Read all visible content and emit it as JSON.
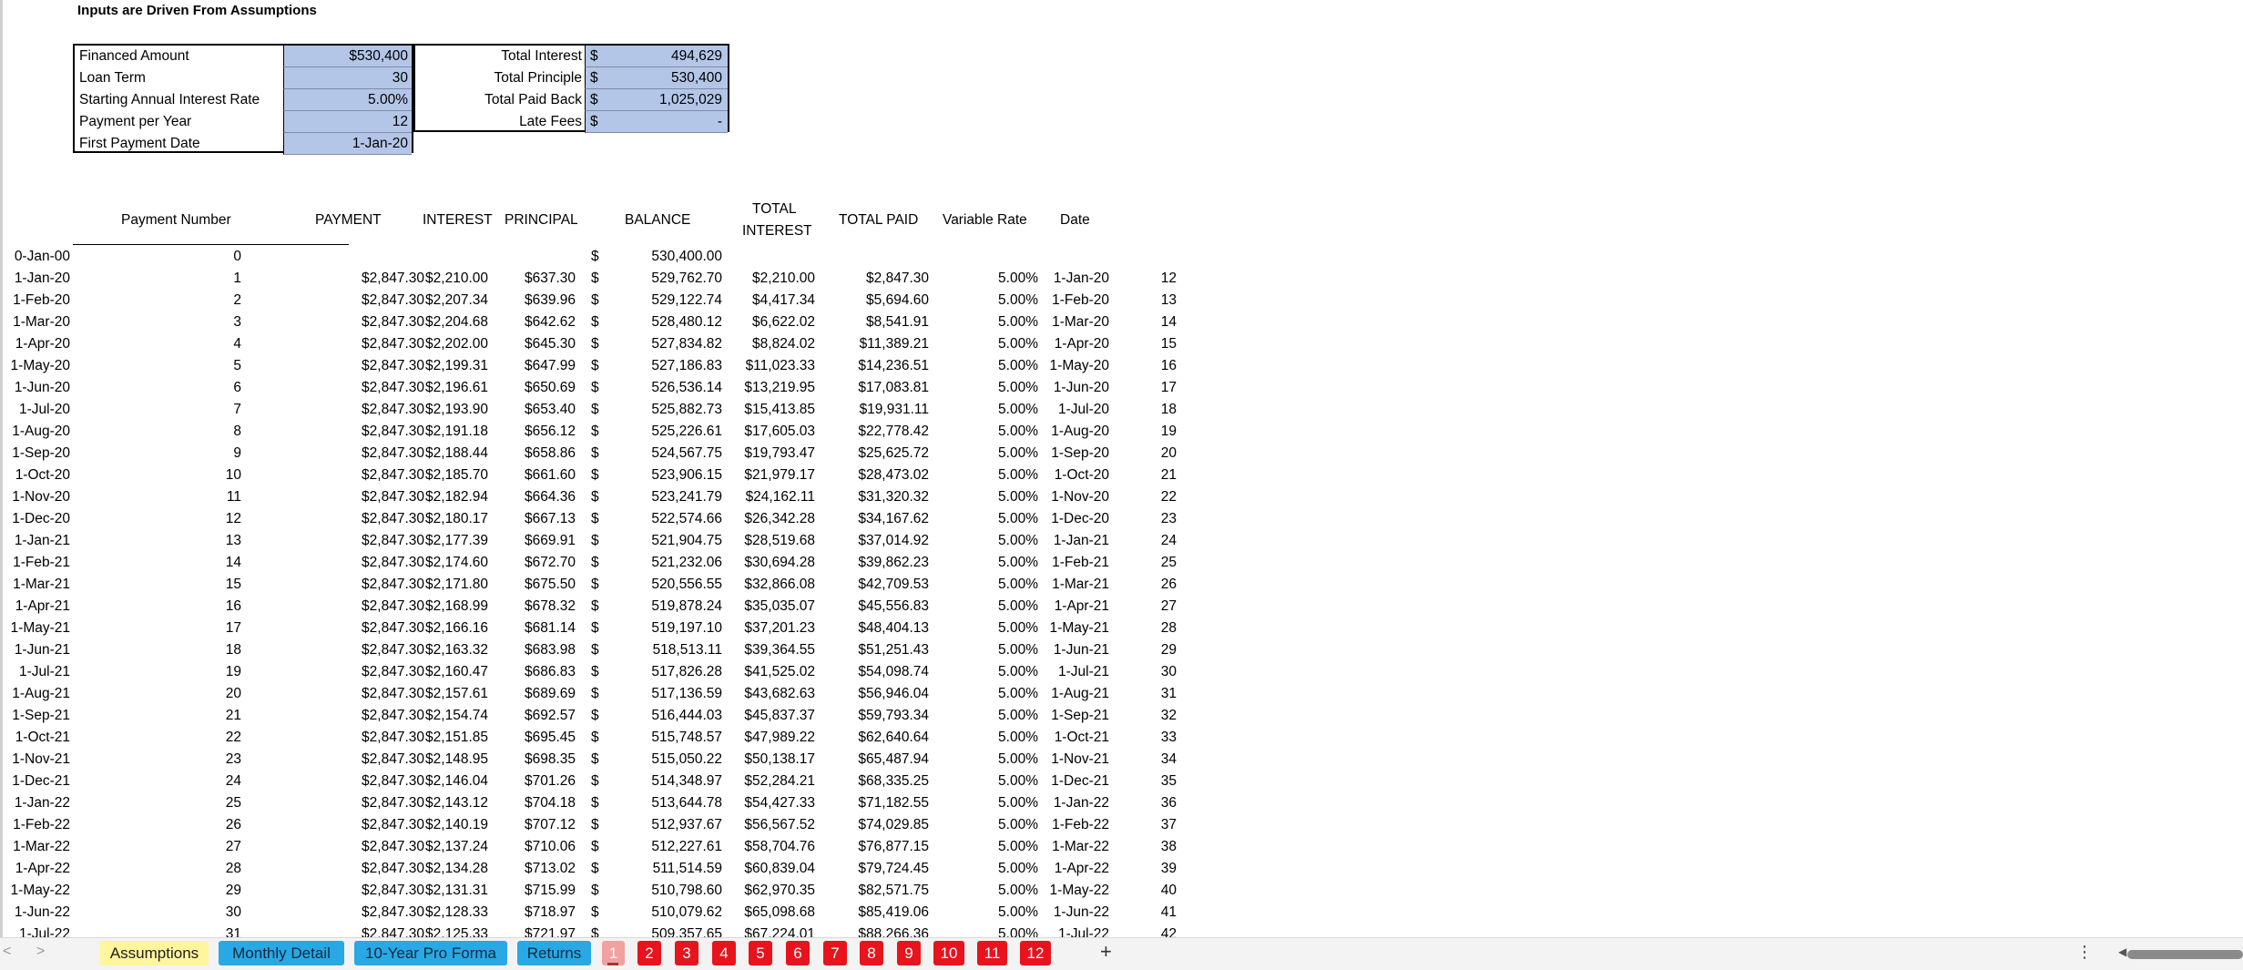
{
  "heading": "Inputs are Driven From Assumptions",
  "inputs": [
    {
      "label": "Financed Amount",
      "value": "$530,400"
    },
    {
      "label": "Loan Term",
      "value": "30"
    },
    {
      "label": "Starting Annual Interest Rate",
      "value": "5.00%"
    },
    {
      "label": "Payment per Year",
      "value": "12"
    },
    {
      "label": "First Payment Date",
      "value": "1-Jan-20"
    }
  ],
  "summary": [
    {
      "label": "Total Interest",
      "currency": "$",
      "value": "494,629"
    },
    {
      "label": "Total Principle",
      "currency": "$",
      "value": "530,400"
    },
    {
      "label": "Total Paid Back",
      "currency": "$",
      "value": "1,025,029"
    },
    {
      "label": "Late Fees",
      "currency": "$",
      "value": "-"
    }
  ],
  "headers": {
    "payment_number": "Payment Number",
    "payment": "PAYMENT",
    "interest": "INTEREST",
    "principal": "PRINCIPAL",
    "balance": "BALANCE",
    "total_interest_1": "TOTAL",
    "total_interest_2": "INTEREST",
    "total_paid": "TOTAL PAID",
    "variable_rate": "Variable  Rate",
    "date": "Date"
  },
  "rows": [
    {
      "date": "0-Jan-00",
      "num": "0",
      "payment": "",
      "interest": "",
      "principal": "",
      "dollar": "$",
      "balance": "530,400.00",
      "total_interest": "",
      "total_paid": "",
      "rate": "",
      "vdate": "",
      "idx": ""
    },
    {
      "date": "1-Jan-20",
      "num": "1",
      "payment": "$2,847.30",
      "interest": "$2,210.00",
      "principal": "$637.30",
      "dollar": "$",
      "balance": "529,762.70",
      "total_interest": "$2,210.00",
      "total_paid": "$2,847.30",
      "rate": "5.00%",
      "vdate": "1-Jan-20",
      "idx": "12"
    },
    {
      "date": "1-Feb-20",
      "num": "2",
      "payment": "$2,847.30",
      "interest": "$2,207.34",
      "principal": "$639.96",
      "dollar": "$",
      "balance": "529,122.74",
      "total_interest": "$4,417.34",
      "total_paid": "$5,694.60",
      "rate": "5.00%",
      "vdate": "1-Feb-20",
      "idx": "13"
    },
    {
      "date": "1-Mar-20",
      "num": "3",
      "payment": "$2,847.30",
      "interest": "$2,204.68",
      "principal": "$642.62",
      "dollar": "$",
      "balance": "528,480.12",
      "total_interest": "$6,622.02",
      "total_paid": "$8,541.91",
      "rate": "5.00%",
      "vdate": "1-Mar-20",
      "idx": "14"
    },
    {
      "date": "1-Apr-20",
      "num": "4",
      "payment": "$2,847.30",
      "interest": "$2,202.00",
      "principal": "$645.30",
      "dollar": "$",
      "balance": "527,834.82",
      "total_interest": "$8,824.02",
      "total_paid": "$11,389.21",
      "rate": "5.00%",
      "vdate": "1-Apr-20",
      "idx": "15"
    },
    {
      "date": "1-May-20",
      "num": "5",
      "payment": "$2,847.30",
      "interest": "$2,199.31",
      "principal": "$647.99",
      "dollar": "$",
      "balance": "527,186.83",
      "total_interest": "$11,023.33",
      "total_paid": "$14,236.51",
      "rate": "5.00%",
      "vdate": "1-May-20",
      "idx": "16"
    },
    {
      "date": "1-Jun-20",
      "num": "6",
      "payment": "$2,847.30",
      "interest": "$2,196.61",
      "principal": "$650.69",
      "dollar": "$",
      "balance": "526,536.14",
      "total_interest": "$13,219.95",
      "total_paid": "$17,083.81",
      "rate": "5.00%",
      "vdate": "1-Jun-20",
      "idx": "17"
    },
    {
      "date": "1-Jul-20",
      "num": "7",
      "payment": "$2,847.30",
      "interest": "$2,193.90",
      "principal": "$653.40",
      "dollar": "$",
      "balance": "525,882.73",
      "total_interest": "$15,413.85",
      "total_paid": "$19,931.11",
      "rate": "5.00%",
      "vdate": "1-Jul-20",
      "idx": "18"
    },
    {
      "date": "1-Aug-20",
      "num": "8",
      "payment": "$2,847.30",
      "interest": "$2,191.18",
      "principal": "$656.12",
      "dollar": "$",
      "balance": "525,226.61",
      "total_interest": "$17,605.03",
      "total_paid": "$22,778.42",
      "rate": "5.00%",
      "vdate": "1-Aug-20",
      "idx": "19"
    },
    {
      "date": "1-Sep-20",
      "num": "9",
      "payment": "$2,847.30",
      "interest": "$2,188.44",
      "principal": "$658.86",
      "dollar": "$",
      "balance": "524,567.75",
      "total_interest": "$19,793.47",
      "total_paid": "$25,625.72",
      "rate": "5.00%",
      "vdate": "1-Sep-20",
      "idx": "20"
    },
    {
      "date": "1-Oct-20",
      "num": "10",
      "payment": "$2,847.30",
      "interest": "$2,185.70",
      "principal": "$661.60",
      "dollar": "$",
      "balance": "523,906.15",
      "total_interest": "$21,979.17",
      "total_paid": "$28,473.02",
      "rate": "5.00%",
      "vdate": "1-Oct-20",
      "idx": "21"
    },
    {
      "date": "1-Nov-20",
      "num": "11",
      "payment": "$2,847.30",
      "interest": "$2,182.94",
      "principal": "$664.36",
      "dollar": "$",
      "balance": "523,241.79",
      "total_interest": "$24,162.11",
      "total_paid": "$31,320.32",
      "rate": "5.00%",
      "vdate": "1-Nov-20",
      "idx": "22"
    },
    {
      "date": "1-Dec-20",
      "num": "12",
      "payment": "$2,847.30",
      "interest": "$2,180.17",
      "principal": "$667.13",
      "dollar": "$",
      "balance": "522,574.66",
      "total_interest": "$26,342.28",
      "total_paid": "$34,167.62",
      "rate": "5.00%",
      "vdate": "1-Dec-20",
      "idx": "23"
    },
    {
      "date": "1-Jan-21",
      "num": "13",
      "payment": "$2,847.30",
      "interest": "$2,177.39",
      "principal": "$669.91",
      "dollar": "$",
      "balance": "521,904.75",
      "total_interest": "$28,519.68",
      "total_paid": "$37,014.92",
      "rate": "5.00%",
      "vdate": "1-Jan-21",
      "idx": "24"
    },
    {
      "date": "1-Feb-21",
      "num": "14",
      "payment": "$2,847.30",
      "interest": "$2,174.60",
      "principal": "$672.70",
      "dollar": "$",
      "balance": "521,232.06",
      "total_interest": "$30,694.28",
      "total_paid": "$39,862.23",
      "rate": "5.00%",
      "vdate": "1-Feb-21",
      "idx": "25"
    },
    {
      "date": "1-Mar-21",
      "num": "15",
      "payment": "$2,847.30",
      "interest": "$2,171.80",
      "principal": "$675.50",
      "dollar": "$",
      "balance": "520,556.55",
      "total_interest": "$32,866.08",
      "total_paid": "$42,709.53",
      "rate": "5.00%",
      "vdate": "1-Mar-21",
      "idx": "26"
    },
    {
      "date": "1-Apr-21",
      "num": "16",
      "payment": "$2,847.30",
      "interest": "$2,168.99",
      "principal": "$678.32",
      "dollar": "$",
      "balance": "519,878.24",
      "total_interest": "$35,035.07",
      "total_paid": "$45,556.83",
      "rate": "5.00%",
      "vdate": "1-Apr-21",
      "idx": "27"
    },
    {
      "date": "1-May-21",
      "num": "17",
      "payment": "$2,847.30",
      "interest": "$2,166.16",
      "principal": "$681.14",
      "dollar": "$",
      "balance": "519,197.10",
      "total_interest": "$37,201.23",
      "total_paid": "$48,404.13",
      "rate": "5.00%",
      "vdate": "1-May-21",
      "idx": "28"
    },
    {
      "date": "1-Jun-21",
      "num": "18",
      "payment": "$2,847.30",
      "interest": "$2,163.32",
      "principal": "$683.98",
      "dollar": "$",
      "balance": "518,513.11",
      "total_interest": "$39,364.55",
      "total_paid": "$51,251.43",
      "rate": "5.00%",
      "vdate": "1-Jun-21",
      "idx": "29"
    },
    {
      "date": "1-Jul-21",
      "num": "19",
      "payment": "$2,847.30",
      "interest": "$2,160.47",
      "principal": "$686.83",
      "dollar": "$",
      "balance": "517,826.28",
      "total_interest": "$41,525.02",
      "total_paid": "$54,098.74",
      "rate": "5.00%",
      "vdate": "1-Jul-21",
      "idx": "30"
    },
    {
      "date": "1-Aug-21",
      "num": "20",
      "payment": "$2,847.30",
      "interest": "$2,157.61",
      "principal": "$689.69",
      "dollar": "$",
      "balance": "517,136.59",
      "total_interest": "$43,682.63",
      "total_paid": "$56,946.04",
      "rate": "5.00%",
      "vdate": "1-Aug-21",
      "idx": "31"
    },
    {
      "date": "1-Sep-21",
      "num": "21",
      "payment": "$2,847.30",
      "interest": "$2,154.74",
      "principal": "$692.57",
      "dollar": "$",
      "balance": "516,444.03",
      "total_interest": "$45,837.37",
      "total_paid": "$59,793.34",
      "rate": "5.00%",
      "vdate": "1-Sep-21",
      "idx": "32"
    },
    {
      "date": "1-Oct-21",
      "num": "22",
      "payment": "$2,847.30",
      "interest": "$2,151.85",
      "principal": "$695.45",
      "dollar": "$",
      "balance": "515,748.57",
      "total_interest": "$47,989.22",
      "total_paid": "$62,640.64",
      "rate": "5.00%",
      "vdate": "1-Oct-21",
      "idx": "33"
    },
    {
      "date": "1-Nov-21",
      "num": "23",
      "payment": "$2,847.30",
      "interest": "$2,148.95",
      "principal": "$698.35",
      "dollar": "$",
      "balance": "515,050.22",
      "total_interest": "$50,138.17",
      "total_paid": "$65,487.94",
      "rate": "5.00%",
      "vdate": "1-Nov-21",
      "idx": "34"
    },
    {
      "date": "1-Dec-21",
      "num": "24",
      "payment": "$2,847.30",
      "interest": "$2,146.04",
      "principal": "$701.26",
      "dollar": "$",
      "balance": "514,348.97",
      "total_interest": "$52,284.21",
      "total_paid": "$68,335.25",
      "rate": "5.00%",
      "vdate": "1-Dec-21",
      "idx": "35"
    },
    {
      "date": "1-Jan-22",
      "num": "25",
      "payment": "$2,847.30",
      "interest": "$2,143.12",
      "principal": "$704.18",
      "dollar": "$",
      "balance": "513,644.78",
      "total_interest": "$54,427.33",
      "total_paid": "$71,182.55",
      "rate": "5.00%",
      "vdate": "1-Jan-22",
      "idx": "36"
    },
    {
      "date": "1-Feb-22",
      "num": "26",
      "payment": "$2,847.30",
      "interest": "$2,140.19",
      "principal": "$707.12",
      "dollar": "$",
      "balance": "512,937.67",
      "total_interest": "$56,567.52",
      "total_paid": "$74,029.85",
      "rate": "5.00%",
      "vdate": "1-Feb-22",
      "idx": "37"
    },
    {
      "date": "1-Mar-22",
      "num": "27",
      "payment": "$2,847.30",
      "interest": "$2,137.24",
      "principal": "$710.06",
      "dollar": "$",
      "balance": "512,227.61",
      "total_interest": "$58,704.76",
      "total_paid": "$76,877.15",
      "rate": "5.00%",
      "vdate": "1-Mar-22",
      "idx": "38"
    },
    {
      "date": "1-Apr-22",
      "num": "28",
      "payment": "$2,847.30",
      "interest": "$2,134.28",
      "principal": "$713.02",
      "dollar": "$",
      "balance": "511,514.59",
      "total_interest": "$60,839.04",
      "total_paid": "$79,724.45",
      "rate": "5.00%",
      "vdate": "1-Apr-22",
      "idx": "39"
    },
    {
      "date": "1-May-22",
      "num": "29",
      "payment": "$2,847.30",
      "interest": "$2,131.31",
      "principal": "$715.99",
      "dollar": "$",
      "balance": "510,798.60",
      "total_interest": "$62,970.35",
      "total_paid": "$82,571.75",
      "rate": "5.00%",
      "vdate": "1-May-22",
      "idx": "40"
    },
    {
      "date": "1-Jun-22",
      "num": "30",
      "payment": "$2,847.30",
      "interest": "$2,128.33",
      "principal": "$718.97",
      "dollar": "$",
      "balance": "510,079.62",
      "total_interest": "$65,098.68",
      "total_paid": "$85,419.06",
      "rate": "5.00%",
      "vdate": "1-Jun-22",
      "idx": "41"
    },
    {
      "date": "1-Jul-22",
      "num": "31",
      "payment": "$2,847.30",
      "interest": "$2,125.33",
      "principal": "$721.97",
      "dollar": "$",
      "balance": "509,357.65",
      "total_interest": "$67,224.01",
      "total_paid": "$88,266.36",
      "rate": "5.00%",
      "vdate": "1-Jul-22",
      "idx": "42"
    }
  ],
  "tabbar": {
    "prev_label": "<",
    "next_label": ">",
    "tabs": [
      {
        "label": "Assumptions",
        "color": "#fff59d"
      },
      {
        "label": "Monthly Detail",
        "color": "#29a8e6"
      },
      {
        "label": "10-Year Pro Forma",
        "color": "#29a8e6"
      },
      {
        "label": "Returns",
        "color": "#29a8e6"
      }
    ],
    "numbered_tabs": [
      "1",
      "2",
      "3",
      "4",
      "5",
      "6",
      "7",
      "8",
      "9",
      "10",
      "11",
      "12"
    ],
    "active_numbered_tab": "1",
    "add_label": "+",
    "more_label": "⋮"
  }
}
